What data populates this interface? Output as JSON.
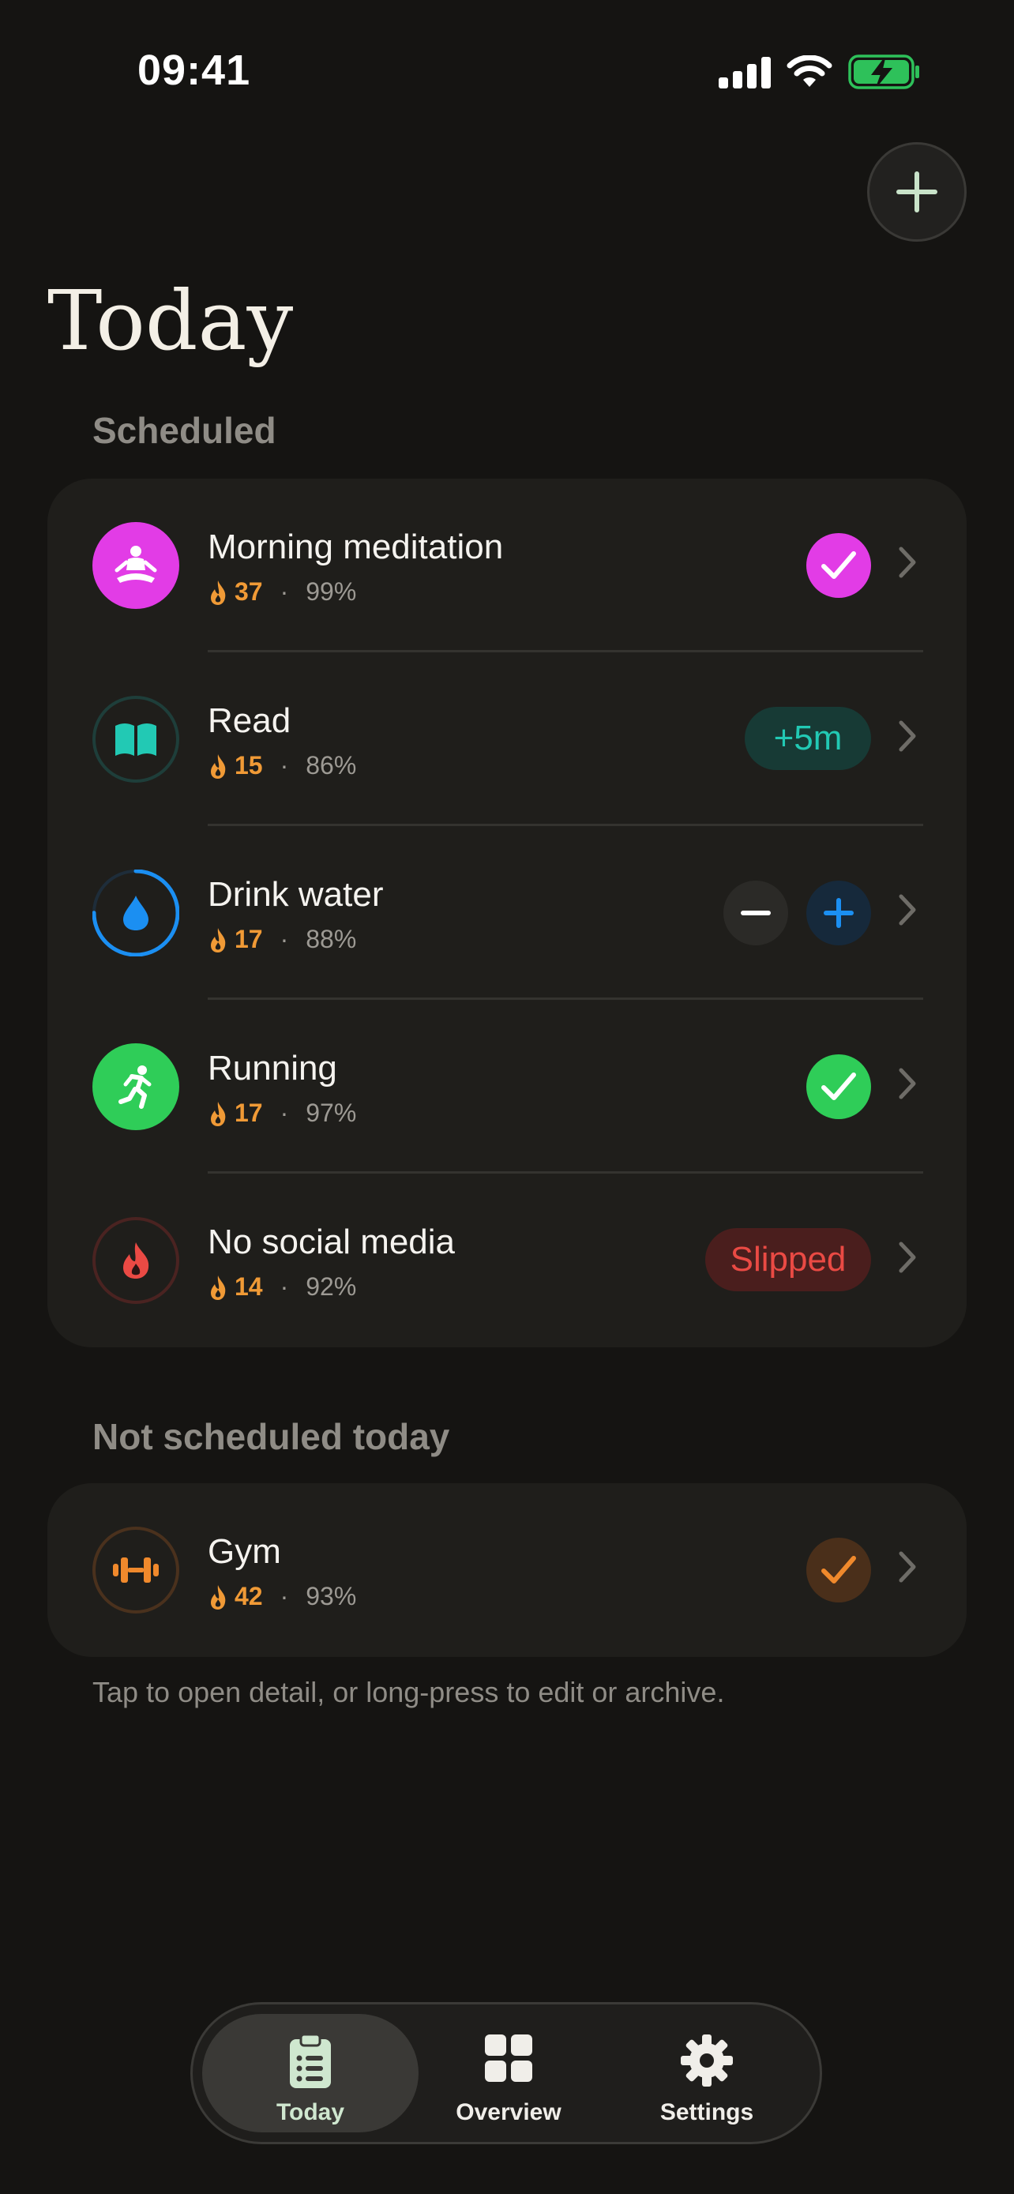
{
  "status_bar": {
    "time": "09:41"
  },
  "header": {
    "title": "Today",
    "add_button_icon": "plus-icon"
  },
  "sections": {
    "scheduled_label": "Scheduled",
    "unscheduled_label": "Not scheduled today"
  },
  "habits": [
    {
      "name": "Morning meditation",
      "streak": "37",
      "rate": "99%",
      "icon": "meditation-icon",
      "color": "#e23ce6",
      "action": "checked"
    },
    {
      "name": "Read",
      "streak": "15",
      "rate": "86%",
      "icon": "book-icon",
      "color": "#22c9b4",
      "action": "+5m"
    },
    {
      "name": "Drink water",
      "streak": "17",
      "rate": "88%",
      "icon": "water-drop-icon",
      "color": "#1b8ff2",
      "action": "stepper",
      "progress": 0.75
    },
    {
      "name": "Running",
      "streak": "17",
      "rate": "97%",
      "icon": "running-icon",
      "color": "#2fcd58",
      "action": "checked"
    },
    {
      "name": "No social media",
      "streak": "14",
      "rate": "92%",
      "icon": "flame-icon",
      "color": "#ea4a44",
      "action": "Slipped"
    }
  ],
  "unscheduled": [
    {
      "name": "Gym",
      "streak": "42",
      "rate": "93%",
      "icon": "dumbbell-icon",
      "color": "#f0892c",
      "action": "checked"
    }
  ],
  "hint": "Tap to open detail, or long-press to edit or archive.",
  "tabs": [
    {
      "label": "Today",
      "icon": "clipboard-icon",
      "active": true
    },
    {
      "label": "Overview",
      "icon": "grid-icon",
      "active": false
    },
    {
      "label": "Settings",
      "icon": "gear-icon",
      "active": false
    }
  ],
  "separator": "·"
}
